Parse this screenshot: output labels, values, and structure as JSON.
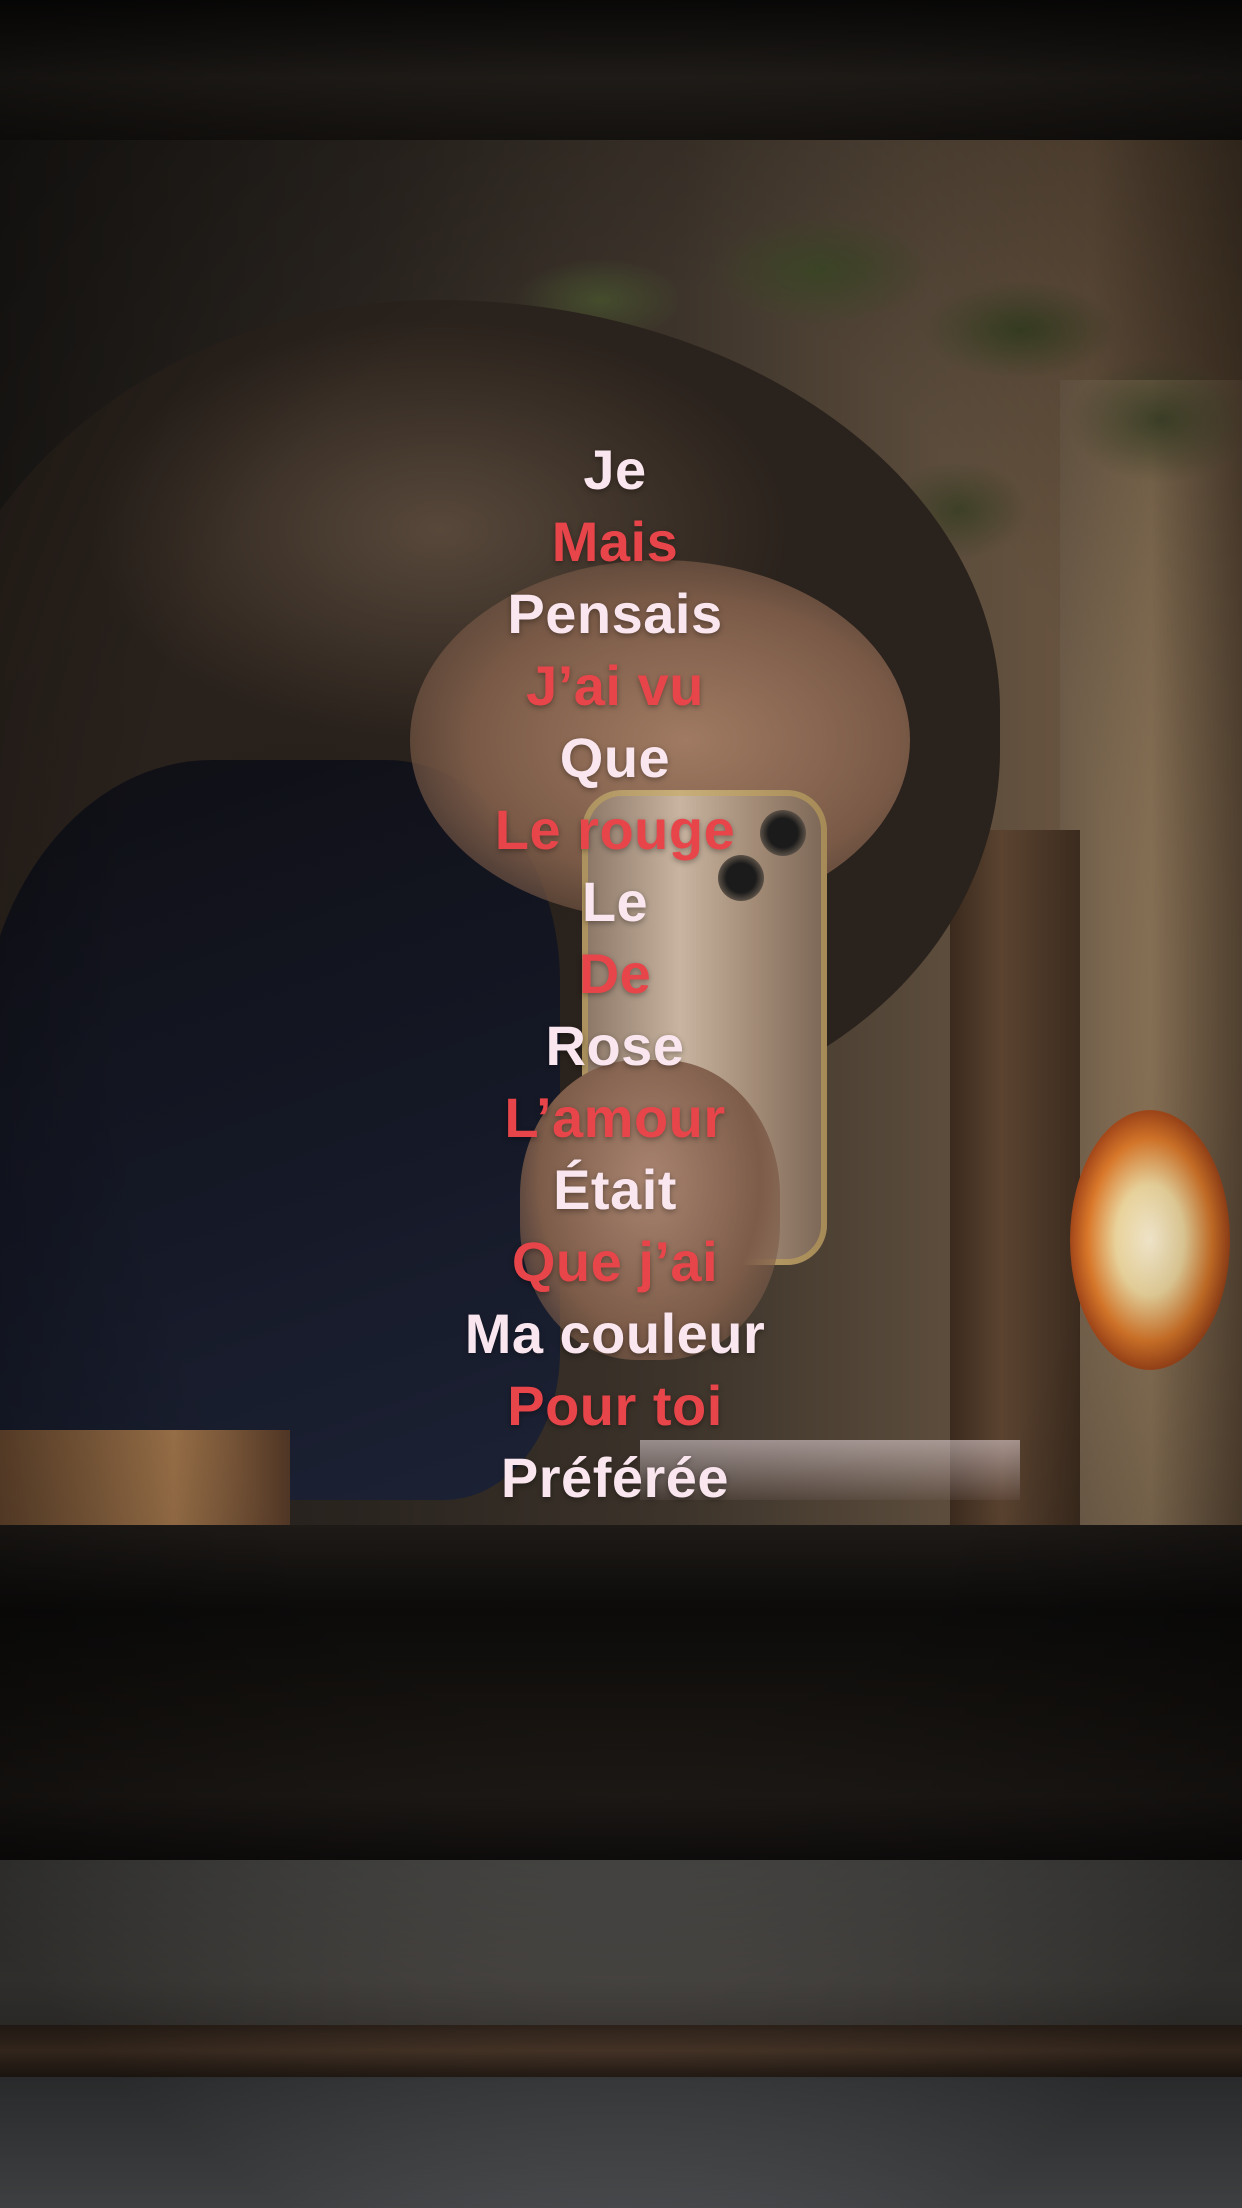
{
  "photo": {
    "description_icon": "mirror-selfie-photo"
  },
  "colors": {
    "white_text": "#fae6ee",
    "red_text": "#e8454a"
  },
  "lyrics": [
    {
      "text": "Je",
      "color": "white"
    },
    {
      "text": "Mais",
      "color": "red"
    },
    {
      "text": "Pensais",
      "color": "white"
    },
    {
      "text": "J’ai vu",
      "color": "red"
    },
    {
      "text": "Que",
      "color": "white"
    },
    {
      "text": "Le rouge",
      "color": "red"
    },
    {
      "text": "Le",
      "color": "white"
    },
    {
      "text": "De",
      "color": "red"
    },
    {
      "text": "Rose",
      "color": "white"
    },
    {
      "text": "L’amour",
      "color": "red"
    },
    {
      "text": "Était",
      "color": "white"
    },
    {
      "text": "Que j’ai",
      "color": "red"
    },
    {
      "text": "Ma couleur",
      "color": "white"
    },
    {
      "text": "Pour toi",
      "color": "red"
    },
    {
      "text": "Préférée",
      "color": "white"
    }
  ]
}
